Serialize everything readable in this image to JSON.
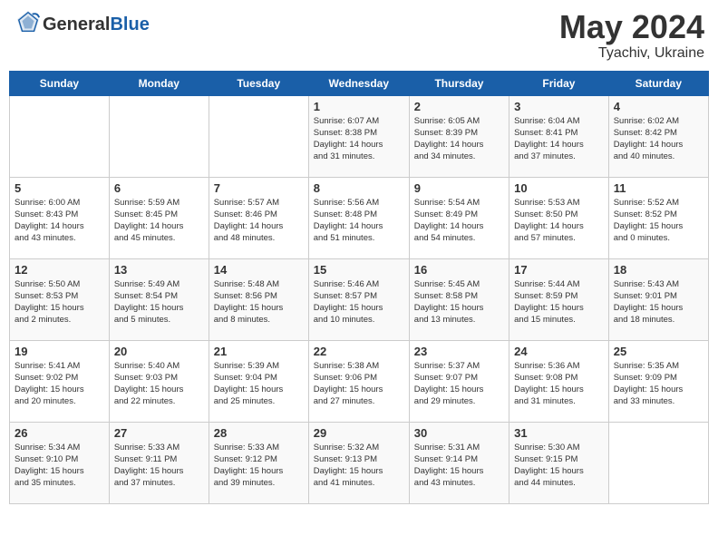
{
  "header": {
    "logo_text_general": "General",
    "logo_text_blue": "Blue",
    "month_year": "May 2024",
    "location": "Tyachiv, Ukraine"
  },
  "calendar": {
    "days_of_week": [
      "Sunday",
      "Monday",
      "Tuesday",
      "Wednesday",
      "Thursday",
      "Friday",
      "Saturday"
    ],
    "weeks": [
      [
        {
          "day": "",
          "info": ""
        },
        {
          "day": "",
          "info": ""
        },
        {
          "day": "",
          "info": ""
        },
        {
          "day": "1",
          "info": "Sunrise: 6:07 AM\nSunset: 8:38 PM\nDaylight: 14 hours\nand 31 minutes."
        },
        {
          "day": "2",
          "info": "Sunrise: 6:05 AM\nSunset: 8:39 PM\nDaylight: 14 hours\nand 34 minutes."
        },
        {
          "day": "3",
          "info": "Sunrise: 6:04 AM\nSunset: 8:41 PM\nDaylight: 14 hours\nand 37 minutes."
        },
        {
          "day": "4",
          "info": "Sunrise: 6:02 AM\nSunset: 8:42 PM\nDaylight: 14 hours\nand 40 minutes."
        }
      ],
      [
        {
          "day": "5",
          "info": "Sunrise: 6:00 AM\nSunset: 8:43 PM\nDaylight: 14 hours\nand 43 minutes."
        },
        {
          "day": "6",
          "info": "Sunrise: 5:59 AM\nSunset: 8:45 PM\nDaylight: 14 hours\nand 45 minutes."
        },
        {
          "day": "7",
          "info": "Sunrise: 5:57 AM\nSunset: 8:46 PM\nDaylight: 14 hours\nand 48 minutes."
        },
        {
          "day": "8",
          "info": "Sunrise: 5:56 AM\nSunset: 8:48 PM\nDaylight: 14 hours\nand 51 minutes."
        },
        {
          "day": "9",
          "info": "Sunrise: 5:54 AM\nSunset: 8:49 PM\nDaylight: 14 hours\nand 54 minutes."
        },
        {
          "day": "10",
          "info": "Sunrise: 5:53 AM\nSunset: 8:50 PM\nDaylight: 14 hours\nand 57 minutes."
        },
        {
          "day": "11",
          "info": "Sunrise: 5:52 AM\nSunset: 8:52 PM\nDaylight: 15 hours\nand 0 minutes."
        }
      ],
      [
        {
          "day": "12",
          "info": "Sunrise: 5:50 AM\nSunset: 8:53 PM\nDaylight: 15 hours\nand 2 minutes."
        },
        {
          "day": "13",
          "info": "Sunrise: 5:49 AM\nSunset: 8:54 PM\nDaylight: 15 hours\nand 5 minutes."
        },
        {
          "day": "14",
          "info": "Sunrise: 5:48 AM\nSunset: 8:56 PM\nDaylight: 15 hours\nand 8 minutes."
        },
        {
          "day": "15",
          "info": "Sunrise: 5:46 AM\nSunset: 8:57 PM\nDaylight: 15 hours\nand 10 minutes."
        },
        {
          "day": "16",
          "info": "Sunrise: 5:45 AM\nSunset: 8:58 PM\nDaylight: 15 hours\nand 13 minutes."
        },
        {
          "day": "17",
          "info": "Sunrise: 5:44 AM\nSunset: 8:59 PM\nDaylight: 15 hours\nand 15 minutes."
        },
        {
          "day": "18",
          "info": "Sunrise: 5:43 AM\nSunset: 9:01 PM\nDaylight: 15 hours\nand 18 minutes."
        }
      ],
      [
        {
          "day": "19",
          "info": "Sunrise: 5:41 AM\nSunset: 9:02 PM\nDaylight: 15 hours\nand 20 minutes."
        },
        {
          "day": "20",
          "info": "Sunrise: 5:40 AM\nSunset: 9:03 PM\nDaylight: 15 hours\nand 22 minutes."
        },
        {
          "day": "21",
          "info": "Sunrise: 5:39 AM\nSunset: 9:04 PM\nDaylight: 15 hours\nand 25 minutes."
        },
        {
          "day": "22",
          "info": "Sunrise: 5:38 AM\nSunset: 9:06 PM\nDaylight: 15 hours\nand 27 minutes."
        },
        {
          "day": "23",
          "info": "Sunrise: 5:37 AM\nSunset: 9:07 PM\nDaylight: 15 hours\nand 29 minutes."
        },
        {
          "day": "24",
          "info": "Sunrise: 5:36 AM\nSunset: 9:08 PM\nDaylight: 15 hours\nand 31 minutes."
        },
        {
          "day": "25",
          "info": "Sunrise: 5:35 AM\nSunset: 9:09 PM\nDaylight: 15 hours\nand 33 minutes."
        }
      ],
      [
        {
          "day": "26",
          "info": "Sunrise: 5:34 AM\nSunset: 9:10 PM\nDaylight: 15 hours\nand 35 minutes."
        },
        {
          "day": "27",
          "info": "Sunrise: 5:33 AM\nSunset: 9:11 PM\nDaylight: 15 hours\nand 37 minutes."
        },
        {
          "day": "28",
          "info": "Sunrise: 5:33 AM\nSunset: 9:12 PM\nDaylight: 15 hours\nand 39 minutes."
        },
        {
          "day": "29",
          "info": "Sunrise: 5:32 AM\nSunset: 9:13 PM\nDaylight: 15 hours\nand 41 minutes."
        },
        {
          "day": "30",
          "info": "Sunrise: 5:31 AM\nSunset: 9:14 PM\nDaylight: 15 hours\nand 43 minutes."
        },
        {
          "day": "31",
          "info": "Sunrise: 5:30 AM\nSunset: 9:15 PM\nDaylight: 15 hours\nand 44 minutes."
        },
        {
          "day": "",
          "info": ""
        }
      ]
    ]
  }
}
